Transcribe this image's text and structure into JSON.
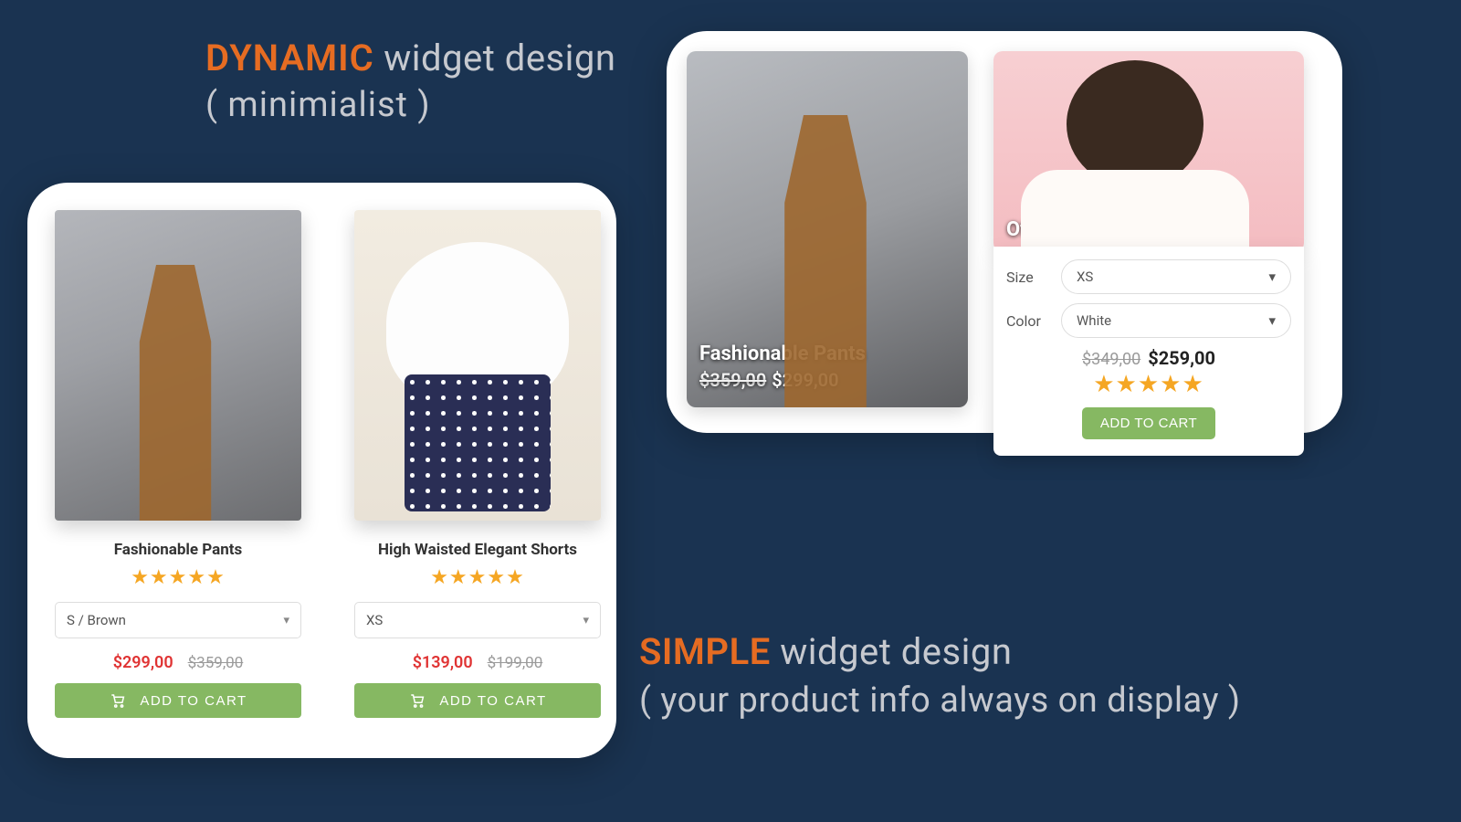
{
  "headings": {
    "dynamic_accent": "DYNAMIC",
    "dynamic_rest": " widget design",
    "dynamic_sub": "( minimialist )",
    "simple_accent": "SIMPLE",
    "simple_rest": " widget design",
    "simple_sub": "( your product info always on display )"
  },
  "dynamic": {
    "products": [
      {
        "name": "Fashionable Pants",
        "variant": "S / Brown",
        "price_now": "$299,00",
        "price_was": "$359,00",
        "button": "ADD TO CART",
        "stars": "★★★★★"
      },
      {
        "name": "High Waisted Elegant Shorts",
        "variant": "XS",
        "price_now": "$139,00",
        "price_was": "$199,00",
        "button": "ADD TO CART",
        "stars": "★★★★★"
      }
    ]
  },
  "simple": {
    "left": {
      "title": "Fashionable Pants",
      "price_was": "$359,00",
      "price_now": "$299,00"
    },
    "right": {
      "title": "Off-the-shoulders Dress",
      "size_label": "Size",
      "size_value": "XS",
      "color_label": "Color",
      "color_value": "White",
      "price_was": "$349,00",
      "price_now": "$259,00",
      "stars": "★★★★★",
      "button": "ADD TO CART"
    }
  }
}
